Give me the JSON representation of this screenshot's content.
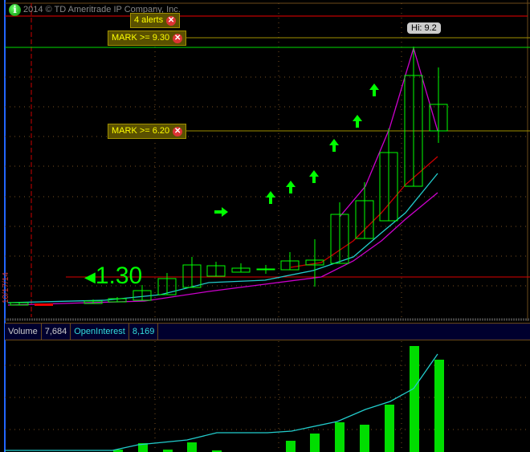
{
  "header": {
    "copyright": "2014 © TD Ameritrade IP Company, Inc.",
    "info_icon": "info-icon"
  },
  "alerts": {
    "count_label": "4 alerts",
    "mark_high": "MARK >= 9.30",
    "mark_mid": "MARK >= 6.20",
    "close_icon": "close-icon"
  },
  "price": {
    "hi_label": "Hi: 9.2",
    "current_bubble": "1.30",
    "date_marker": "10/17/14"
  },
  "volume_panel": {
    "volume_label": "Volume",
    "volume_value": "7,684",
    "oi_label": "OpenInterest",
    "oi_value": "8,169"
  },
  "colors": {
    "candle": "#00ff00",
    "ma_cyan": "#22cccc",
    "ma_magenta": "#cc00cc",
    "ma_red": "#cc0000",
    "volume_bar": "#00dd00"
  }
}
